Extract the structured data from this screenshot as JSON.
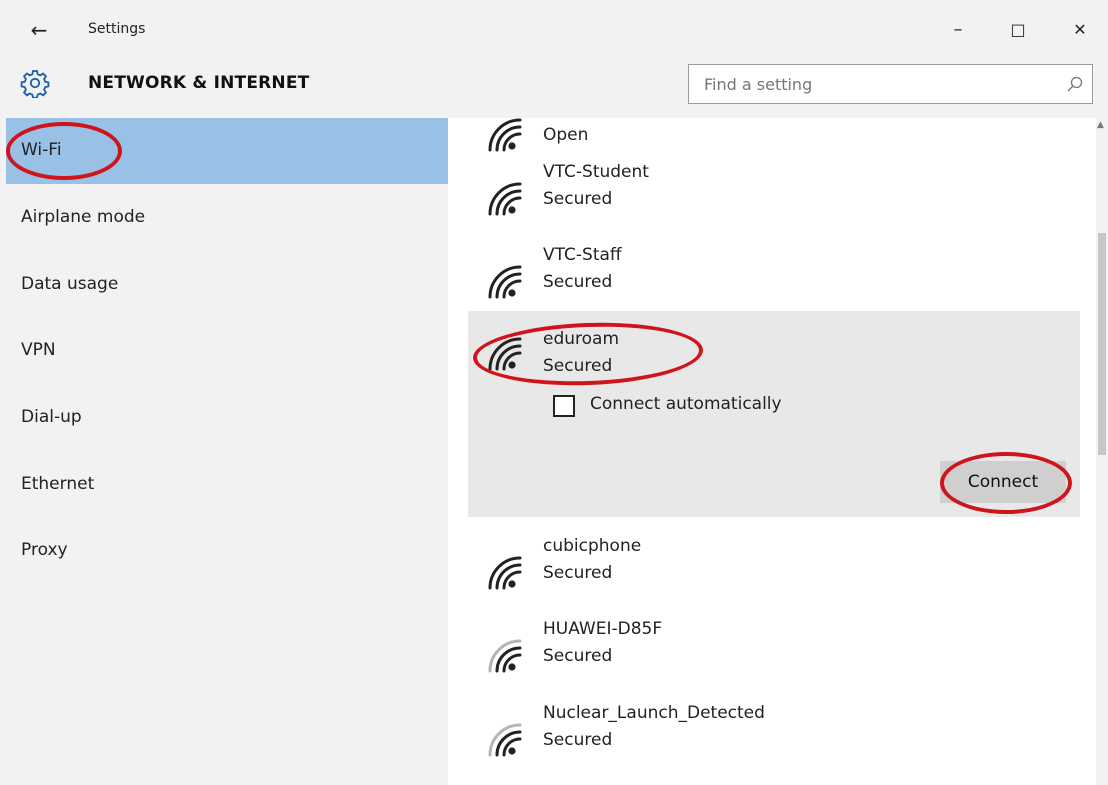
{
  "window": {
    "title": "Settings",
    "back_icon": "back-arrow-icon",
    "minimize": "–",
    "maximize": "□",
    "close": "✕"
  },
  "header": {
    "icon": "gear-icon",
    "section_title": "NETWORK & INTERNET",
    "search_placeholder": "Find a setting"
  },
  "sidebar": {
    "items": [
      {
        "label": "Wi-Fi",
        "selected": true
      },
      {
        "label": "Airplane mode"
      },
      {
        "label": "Data usage"
      },
      {
        "label": "VPN"
      },
      {
        "label": "Dial-up"
      },
      {
        "label": "Ethernet"
      },
      {
        "label": "Proxy"
      }
    ]
  },
  "networks": {
    "partial_top": {
      "status": "Open"
    },
    "list": [
      {
        "name": "VTC-Student",
        "status": "Secured"
      },
      {
        "name": "VTC-Staff",
        "status": "Secured"
      },
      {
        "name": "eduroam",
        "status": "Secured",
        "expanded": true
      },
      {
        "name": "cubicphone",
        "status": "Secured"
      },
      {
        "name": "HUAWEI-D85F",
        "status": "Secured"
      },
      {
        "name": "Nuclear_Launch_Detected",
        "status": "Secured"
      }
    ],
    "connect_automatically_label": "Connect automatically",
    "connect_automatically_checked": false,
    "connect_button": "Connect"
  },
  "colors": {
    "selected_nav": "#99c1e6",
    "annotation": "#d0141c",
    "expanded_bg": "#e8e8e8"
  }
}
